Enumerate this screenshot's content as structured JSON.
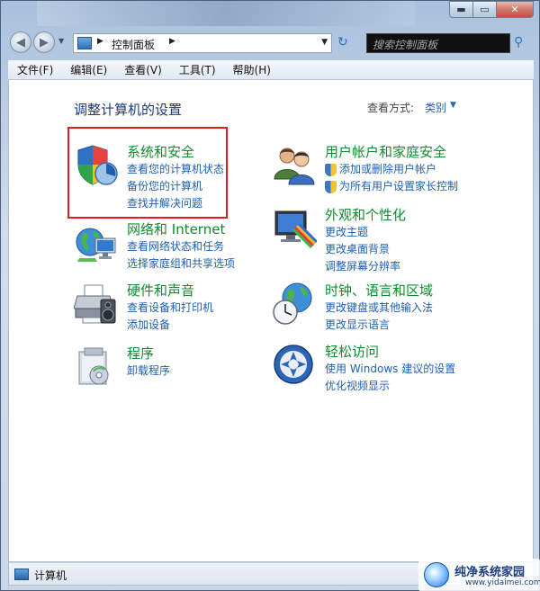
{
  "window": {
    "controls": {
      "minimize": "▬",
      "maximize": "▭",
      "close": "✕"
    }
  },
  "nav": {
    "back_icon": "◀",
    "forward_icon": "▶",
    "recent_icon": "▼",
    "breadcrumb_sep": "▶",
    "breadcrumb": "控制面板",
    "dropdown_icon": "▼",
    "refresh_icon": "↻",
    "search_placeholder": "搜索控制面板",
    "search_icon": "⚲"
  },
  "menubar": {
    "items": [
      "文件(F)",
      "编辑(E)",
      "查看(V)",
      "工具(T)",
      "帮助(H)"
    ]
  },
  "content": {
    "title": "调整计算机的设置",
    "view_by_label": "查看方式:",
    "view_by_value": "类别",
    "view_caret": "▼",
    "categories": [
      {
        "title": "系统和安全",
        "links": [
          "查看您的计算机状态",
          "备份您的计算机",
          "查找并解决问题"
        ],
        "icon": "security-shield-icon"
      },
      {
        "title": "网络和 Internet",
        "links": [
          "查看网络状态和任务",
          "选择家庭组和共享选项"
        ],
        "icon": "network-globe-icon"
      },
      {
        "title": "硬件和声音",
        "links": [
          "查看设备和打印机",
          "添加设备"
        ],
        "icon": "printer-speaker-icon"
      },
      {
        "title": "程序",
        "links": [
          "卸载程序"
        ],
        "icon": "programs-box-icon"
      },
      {
        "title": "用户帐户和家庭安全",
        "links": [
          "添加或删除用户帐户",
          "为所有用户设置家长控制"
        ],
        "icon": "users-icon"
      },
      {
        "title": "外观和个性化",
        "links": [
          "更改主题",
          "更改桌面背景",
          "调整屏幕分辨率"
        ],
        "icon": "monitor-palette-icon"
      },
      {
        "title": "时钟、语言和区域",
        "links": [
          "更改键盘或其他输入法",
          "更改显示语言"
        ],
        "icon": "clock-globe-icon"
      },
      {
        "title": "轻松访问",
        "links": [
          "使用 Windows 建议的设置",
          "优化视频显示"
        ],
        "icon": "ease-of-access-icon"
      }
    ]
  },
  "statusbar": {
    "text": "计算机"
  },
  "watermark": {
    "title": "纯净系统家园",
    "url": "www.yidaimei.com"
  },
  "colors": {
    "category_title": "#0f8c2e",
    "link": "#1d5fb3",
    "highlight": "#e02020",
    "page_title": "#1b3a79"
  }
}
